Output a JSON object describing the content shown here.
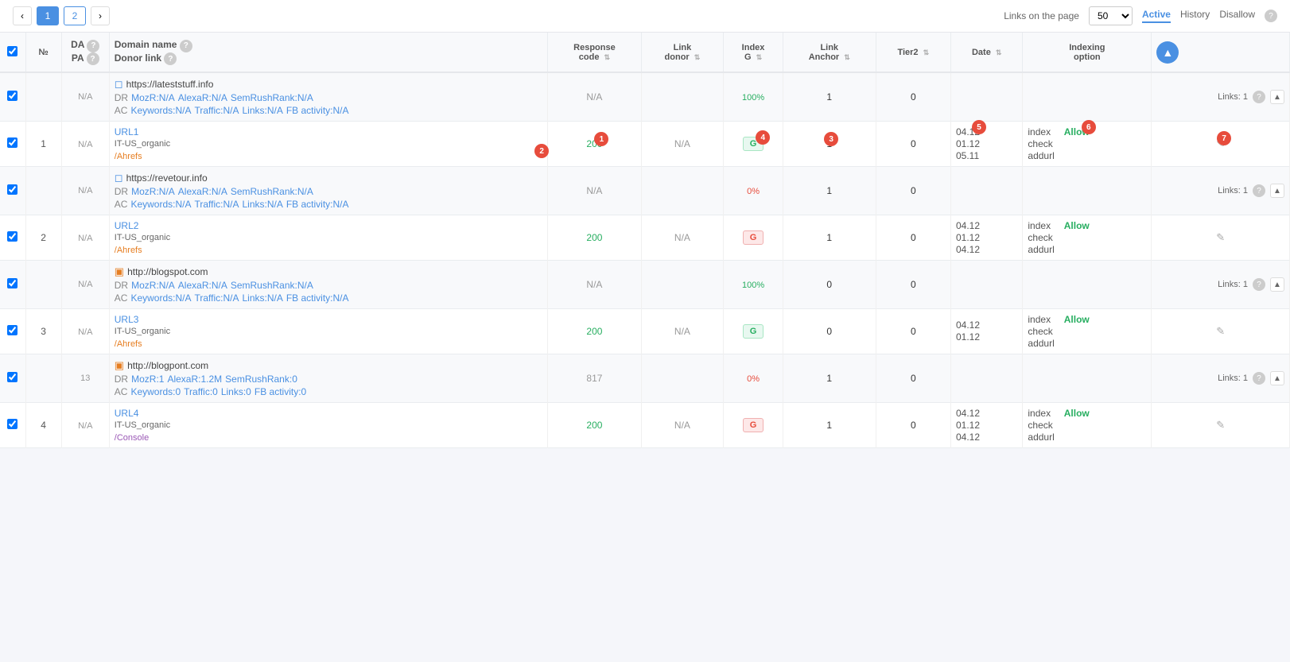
{
  "topBar": {
    "pagination": {
      "prevLabel": "‹",
      "nextLabel": "›",
      "pages": [
        "1",
        "2"
      ],
      "activePage": "1"
    },
    "linksOnPage": {
      "label": "Links on the page",
      "value": "50"
    },
    "tabs": [
      {
        "id": "active",
        "label": "Active",
        "active": true
      },
      {
        "id": "history",
        "label": "History",
        "active": false
      },
      {
        "id": "disallow",
        "label": "Disallow",
        "active": false
      }
    ],
    "helpIcon": "?"
  },
  "table": {
    "columns": [
      {
        "id": "checkbox",
        "label": ""
      },
      {
        "id": "num",
        "label": "№"
      },
      {
        "id": "dapa",
        "label1": "DA",
        "label2": "PA",
        "hasHelp": true
      },
      {
        "id": "domain",
        "label": "Domain name",
        "sublabel": "Donor link",
        "hasHelp": true
      },
      {
        "id": "response",
        "label": "Response code",
        "hasSort": true
      },
      {
        "id": "linkdonor",
        "label": "Link donor",
        "hasSort": true
      },
      {
        "id": "indexg",
        "label": "Index G",
        "hasSort": true
      },
      {
        "id": "linkanchor",
        "label": "Link Anchor",
        "hasSort": true
      },
      {
        "id": "tier2",
        "label": "Tier2",
        "hasSort": true
      },
      {
        "id": "date",
        "label": "Date",
        "hasSort": true
      },
      {
        "id": "indexing",
        "label": "Indexing option"
      },
      {
        "id": "actions",
        "label": ""
      }
    ],
    "domainRows": [
      {
        "id": "domain1",
        "domain": "https://lateststuff.info",
        "domainIcon": "🌐",
        "da": "N/A",
        "pa": "N/A",
        "dr": "N/A",
        "mozR": "MozR:N/A",
        "alexaR": "AlexaR:N/A",
        "semrush": "SemRushRank:N/A",
        "keywords": "Keywords:N/A",
        "traffic": "Traffic:N/A",
        "links": "Links:N/A",
        "fbActivity": "FB activity:N/A",
        "response": "N/A",
        "indexG": "100%",
        "indexGClass": "green-text",
        "linkAnchor": "1",
        "tier2": "0",
        "linksCount": "Links: 1",
        "urlRows": [
          {
            "num": "1",
            "url": "URL1",
            "category": "IT-US_organic",
            "source": "/Ahrefs",
            "sourceBadge": "2",
            "response": "200",
            "linkDonor": "N/A",
            "indexG": "G",
            "indexGClass": "green",
            "linkAnchor": "1",
            "tier2": "0",
            "indexing1": "index",
            "indexing2": "check",
            "indexing3": "addurl",
            "date1": "04.12",
            "date2": "01.12",
            "date3": "05.11",
            "allow": "Allow",
            "responseBadge": "1",
            "indexBadge": "4",
            "anchorBadge": "3",
            "dateBadge": "5",
            "allowBadge": "6",
            "actionBadge": "7"
          }
        ]
      },
      {
        "id": "domain2",
        "domain": "https://revetour.info",
        "domainIcon": "🌐",
        "da": "N/A",
        "pa": "N/A",
        "dr": "N/A",
        "mozR": "MozR:N/A",
        "alexaR": "AlexaR:N/A",
        "semrush": "SemRushRank:N/A",
        "keywords": "Keywords:N/A",
        "traffic": "Traffic:N/A",
        "links": "Links:N/A",
        "fbActivity": "FB activity:N/A",
        "response": "N/A",
        "indexG": "0%",
        "indexGClass": "red-text",
        "linkAnchor": "1",
        "tier2": "0",
        "linksCount": "Links: 1",
        "urlRows": [
          {
            "num": "2",
            "url": "URL2",
            "category": "IT-US_organic",
            "source": "/Ahrefs",
            "sourceBadge": "",
            "response": "200",
            "linkDonor": "N/A",
            "indexG": "G",
            "indexGClass": "pink",
            "linkAnchor": "1",
            "tier2": "0",
            "indexing1": "index",
            "indexing2": "check",
            "indexing3": "addurl",
            "date1": "04.12",
            "date2": "01.12",
            "date3": "04.12",
            "allow": "Allow"
          }
        ]
      },
      {
        "id": "domain3",
        "domain": "http://blogspot.com",
        "domainIcon": "🟠",
        "da": "N/A",
        "pa": "N/A",
        "dr": "N/A",
        "mozR": "MozR:N/A",
        "alexaR": "AlexaR:N/A",
        "semrush": "SemRushRank:N/A",
        "keywords": "Keywords:N/A",
        "traffic": "Traffic:N/A",
        "links": "Links:N/A",
        "fbActivity": "FB activity:N/A",
        "response": "N/A",
        "indexG": "100%",
        "indexGClass": "green-text",
        "linkAnchor": "0",
        "tier2": "0",
        "linksCount": "Links: 1",
        "urlRows": [
          {
            "num": "3",
            "url": "URL3",
            "category": "IT-US_organic",
            "source": "/Ahrefs",
            "sourceBadge": "",
            "response": "200",
            "linkDonor": "N/A",
            "indexG": "G",
            "indexGClass": "green",
            "linkAnchor": "0",
            "tier2": "0",
            "indexing1": "index",
            "indexing2": "check",
            "indexing3": "addurl",
            "date1": "04.12",
            "date2": "01.12",
            "date3": "",
            "allow": "Allow"
          }
        ]
      },
      {
        "id": "domain4",
        "domain": "http://blogpont.com",
        "domainIcon": "🌐",
        "da": "13",
        "pa": "N/A",
        "dr": "1",
        "mozR": "MozR:1",
        "alexaR": "AlexaR:1.2M",
        "semrush": "SemRushRank:0",
        "keywords": "Keywords:0",
        "traffic": "Traffic:0",
        "links": "Links:0",
        "fbActivity": "FB activity:0",
        "response": "817",
        "indexG": "0%",
        "indexGClass": "red-text",
        "linkAnchor": "1",
        "tier2": "0",
        "linksCount": "Links: 1",
        "urlRows": [
          {
            "num": "4",
            "url": "URL4",
            "category": "IT-US_organic",
            "source": "/Console",
            "sourceBadge": "",
            "response": "200",
            "linkDonor": "N/A",
            "indexG": "G",
            "indexGClass": "pink",
            "linkAnchor": "1",
            "tier2": "0",
            "indexing1": "index",
            "indexing2": "check",
            "indexing3": "addurl",
            "date1": "04.12",
            "date2": "01.12",
            "date3": "04.12",
            "allow": "Allow"
          }
        ]
      }
    ]
  }
}
